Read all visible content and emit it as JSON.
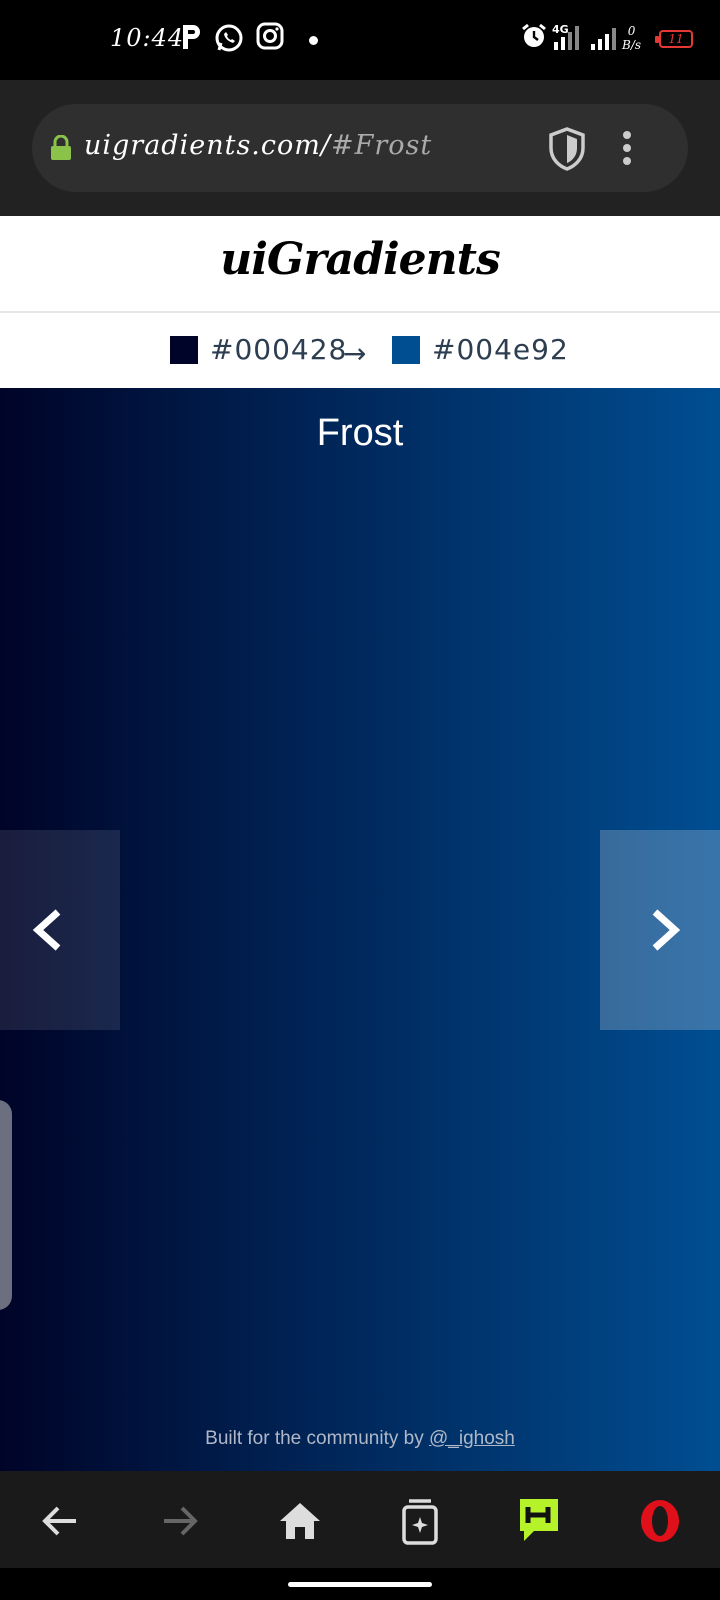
{
  "status_bar": {
    "time": "10:44",
    "net_speed_value": "0",
    "net_speed_unit": "B/s",
    "network": "4G",
    "battery": "11"
  },
  "browser": {
    "url_host": "uigradients.com/",
    "url_hash": "#Frost"
  },
  "site": {
    "logo": "uiGradients"
  },
  "colors": {
    "from_hex": "#000428",
    "to_hex": "#004e92",
    "arrow": "→"
  },
  "gradient": {
    "name": "Frost"
  },
  "footer": {
    "text": "Built for the community by ",
    "link": "@_ighosh"
  },
  "theme": {
    "accent_green": "#8bc34a",
    "opera_red": "#e0101b",
    "battery_red": "#e53935"
  }
}
